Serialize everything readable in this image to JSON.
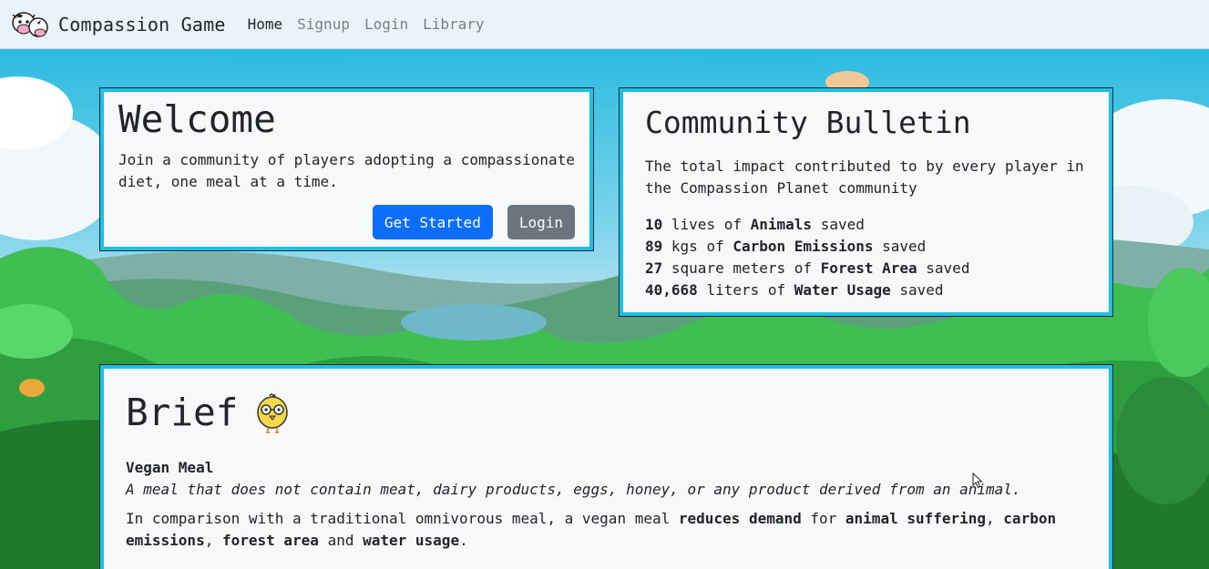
{
  "navbar": {
    "brand": "Compassion Game",
    "links": [
      {
        "label": "Home",
        "active": true
      },
      {
        "label": "Signup",
        "active": false
      },
      {
        "label": "Login",
        "active": false
      },
      {
        "label": "Library",
        "active": false
      }
    ]
  },
  "welcome": {
    "title": "Welcome",
    "text": "Join a community of players adopting a compassionate diet, one meal at a time.",
    "get_started_label": "Get Started",
    "login_label": "Login"
  },
  "bulletin": {
    "title": "Community Bulletin",
    "intro": "The total impact contributed to by every player in the Compassion Planet community",
    "stats": [
      {
        "value": "10",
        "mid": "lives of",
        "category": "Animals",
        "end": "saved"
      },
      {
        "value": "89",
        "mid": "kgs of",
        "category": "Carbon Emissions",
        "end": "saved"
      },
      {
        "value": "27",
        "mid": "square meters of",
        "category": "Forest Area",
        "end": "saved"
      },
      {
        "value": "40,668",
        "mid": "liters of",
        "category": "Water Usage",
        "end": "saved"
      }
    ]
  },
  "brief": {
    "title": "Brief",
    "term": "Vegan Meal",
    "definition": "A meal that does not contain meat, dairy products, eggs, honey, or any product derived from an animal.",
    "comparison": {
      "p1": "In comparison with a traditional omnivorous meal, a vegan meal ",
      "b1": "reduces demand",
      "p2": " for ",
      "b2": "animal suffering",
      "p3": ", ",
      "b3": "carbon emissions",
      "p4": ", ",
      "b4": "forest area",
      "p5": " and ",
      "b5": "water usage",
      "p6": "."
    }
  },
  "colors": {
    "card_border": "#1ec1e6",
    "primary": "#0d6efd",
    "secondary": "#6c757d",
    "navbar_bg": "#e8f3fc"
  },
  "icons": {
    "brand": "cow-logo-icon",
    "brief": "chick-with-glasses-icon"
  }
}
